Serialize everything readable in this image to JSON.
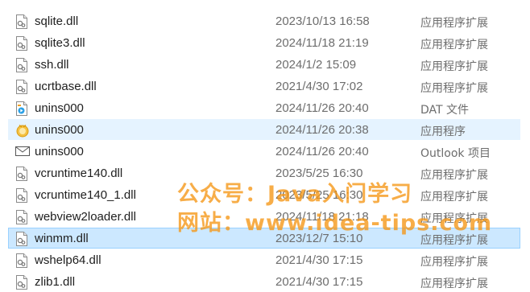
{
  "files": [
    {
      "name": "sqlite.dll",
      "date": "2023/10/13 16:58",
      "type": "应用程序扩展",
      "icon": "dll-file-icon",
      "state": ""
    },
    {
      "name": "sqlite3.dll",
      "date": "2024/11/18 21:19",
      "type": "应用程序扩展",
      "icon": "dll-file-icon",
      "state": ""
    },
    {
      "name": "ssh.dll",
      "date": "2024/1/2 15:09",
      "type": "应用程序扩展",
      "icon": "dll-file-icon",
      "state": ""
    },
    {
      "name": "ucrtbase.dll",
      "date": "2021/4/30 17:02",
      "type": "应用程序扩展",
      "icon": "dll-file-icon",
      "state": ""
    },
    {
      "name": "unins000",
      "date": "2024/11/26 20:40",
      "type": "DAT 文件",
      "icon": "media-file-icon",
      "state": ""
    },
    {
      "name": "unins000",
      "date": "2024/11/26 20:38",
      "type": "应用程序",
      "icon": "uninstaller-app-icon",
      "state": "hover"
    },
    {
      "name": "unins000",
      "date": "2024/11/26 20:40",
      "type": "Outlook 项目",
      "icon": "mail-envelope-icon",
      "state": ""
    },
    {
      "name": "vcruntime140.dll",
      "date": "2023/5/25 16:30",
      "type": "应用程序扩展",
      "icon": "dll-file-icon",
      "state": ""
    },
    {
      "name": "vcruntime140_1.dll",
      "date": "2023/5/25 16:30",
      "type": "应用程序扩展",
      "icon": "dll-file-icon",
      "state": ""
    },
    {
      "name": "webview2loader.dll",
      "date": "2024/11/18 21:18",
      "type": "应用程序扩展",
      "icon": "dll-file-icon",
      "state": ""
    },
    {
      "name": "winmm.dll",
      "date": "2023/12/7 15:10",
      "type": "应用程序扩展",
      "icon": "dll-file-icon",
      "state": "selected"
    },
    {
      "name": "wshelp64.dll",
      "date": "2021/4/30 17:15",
      "type": "应用程序扩展",
      "icon": "dll-file-icon",
      "state": ""
    },
    {
      "name": "zlib1.dll",
      "date": "2021/4/30 17:15",
      "type": "应用程序扩展",
      "icon": "dll-file-icon",
      "state": ""
    }
  ],
  "watermark": {
    "line1": "公众号：Java入门学习",
    "line2": "网站：www.idea-tips.com"
  },
  "colors": {
    "hover": "#e5f3ff",
    "selected": "#cce8ff",
    "selected_border": "#99d1ff",
    "watermark": "#f59614"
  }
}
